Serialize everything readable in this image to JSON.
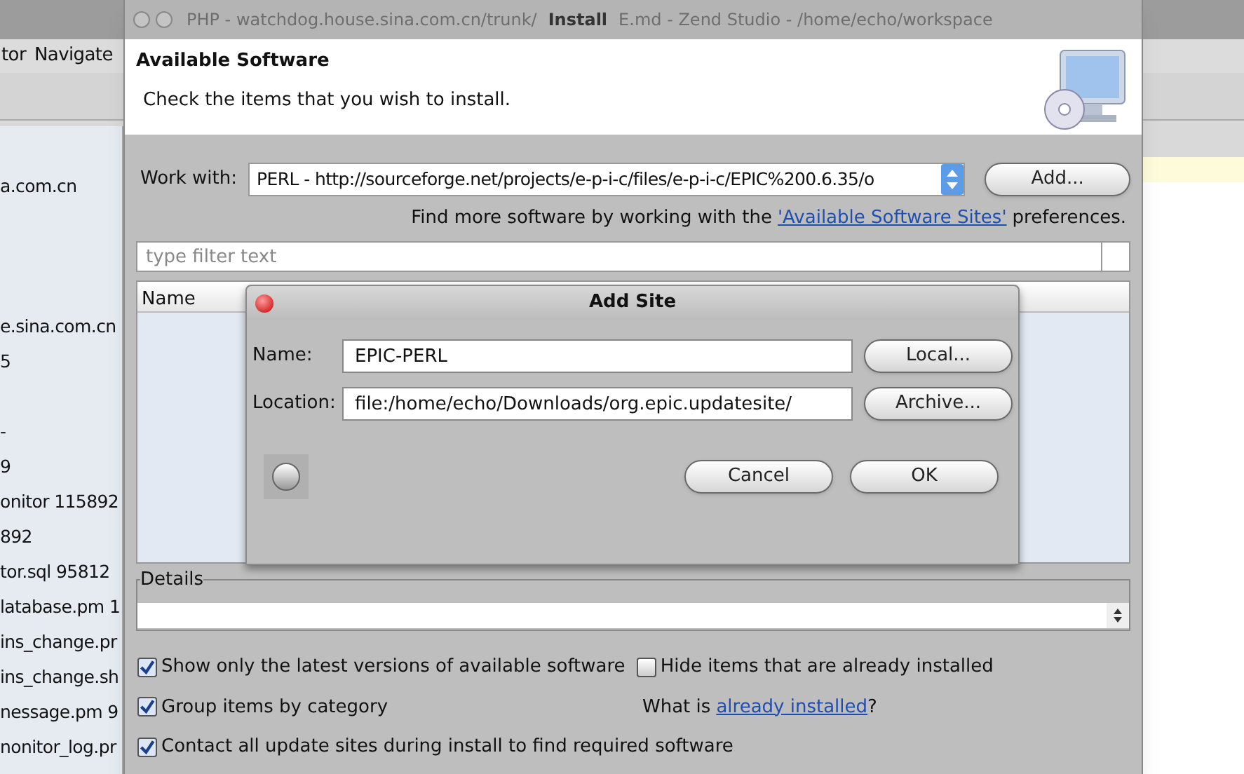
{
  "background_window": {
    "title_left": "PHP - watchdog.house.sina.com.cn/trunk/",
    "title_right": "E.md - Zend Studio - /home/echo/workspace",
    "menu": [
      "tor",
      "Navigate"
    ],
    "explorer_groups": [
      [
        "a.com.cn"
      ],
      [
        "e.sina.com.cn",
        "5"
      ],
      [
        "-",
        "9",
        "onitor 115892",
        "892",
        "tor.sql 95812",
        "latabase.pm 1",
        "ins_change.pr",
        "ins_change.sh",
        "nessage.pm 9",
        "nonitor_log.pr"
      ]
    ]
  },
  "install_dialog": {
    "title": "Install",
    "header_title": "Available Software",
    "header_subtitle": "Check the items that you wish to install.",
    "work_with": {
      "label": "Work with:",
      "value": "PERL - http://sourceforge.net/projects/e-p-i-c/files/e-p-i-c/EPIC%200.6.35/o"
    },
    "add_button": "Add...",
    "find_more": {
      "before": "Find more software by working with the",
      "link": "'Available Software Sites'",
      "after": "preferences."
    },
    "filter": {
      "placeholder": "type filter text"
    },
    "table": {
      "columns": [
        "Name"
      ]
    },
    "details": {
      "label": "Details"
    },
    "options": [
      {
        "label": "Show only the latest versions of available software",
        "checked": true
      },
      {
        "label": "Hide items that are already installed",
        "checked": false
      },
      {
        "label": "Group items by category",
        "checked": true
      },
      {
        "label": "Contact all update sites during install to find required software",
        "checked": true
      }
    ],
    "what_is": {
      "before": "What is",
      "link": "already installed",
      "after": "?"
    }
  },
  "add_site_dialog": {
    "title": "Add Site",
    "fields": [
      {
        "label": "Name:",
        "value": "EPIC-PERL",
        "button": "Local..."
      },
      {
        "label": "Location:",
        "value": "file:/home/echo/Downloads/org.epic.updatesite/",
        "button": "Archive..."
      }
    ],
    "buttons": [
      "Cancel",
      "OK"
    ]
  }
}
